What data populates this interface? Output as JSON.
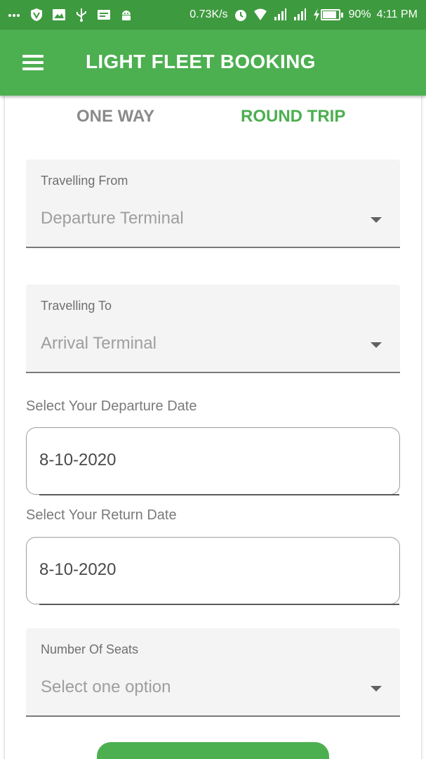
{
  "status_bar": {
    "network_speed": "0.73K/s",
    "battery_percent": "90%",
    "battery_level": 0.9,
    "time": "4:11 PM",
    "icons": [
      "more-dots-icon",
      "vpn-shield-icon",
      "image-icon",
      "usb-icon",
      "message-icon",
      "android-icon",
      "alarm-icon",
      "wifi-icon",
      "signal-icon",
      "signal-icon",
      "charging-icon",
      "battery-icon"
    ]
  },
  "app_bar": {
    "title": "LIGHT FLEET BOOKING",
    "menu_icon": "hamburger-menu-icon"
  },
  "tabs": {
    "one_way": "ONE WAY",
    "round_trip": "ROUND TRIP",
    "selected": "round_trip"
  },
  "form": {
    "from": {
      "label": "Travelling From",
      "placeholder": "Departure Terminal"
    },
    "to": {
      "label": "Travelling To",
      "placeholder": "Arrival Terminal"
    },
    "departure_date": {
      "label": "Select Your Departure Date",
      "value": "8-10-2020"
    },
    "return_date": {
      "label": "Select Your Return Date",
      "value": "8-10-2020"
    },
    "seats": {
      "label": "Number Of Seats",
      "placeholder": "Select one option"
    }
  },
  "colors": {
    "status_bar": "#3e9a3f",
    "primary": "#4caf50",
    "inactive_tab": "#8a8a8a"
  }
}
